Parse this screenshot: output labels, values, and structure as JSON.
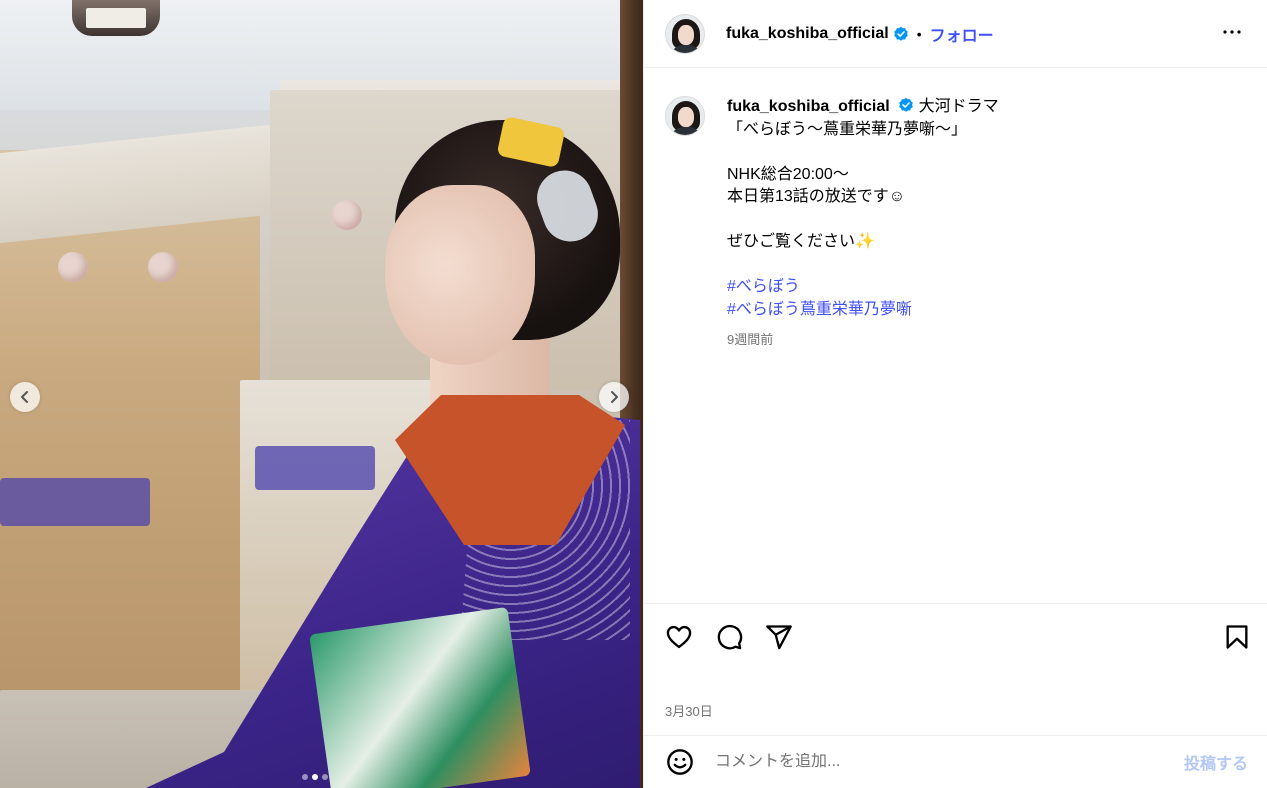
{
  "header": {
    "username": "fuka_koshiba_official",
    "separator": "•",
    "follow_label": "フォロー"
  },
  "caption": {
    "username": "fuka_koshiba_official",
    "lines": [
      "大河ドラマ",
      "「べらぼう～蔦重栄華乃夢噺～」",
      "",
      "NHK総合20:00～",
      "本日第13話の放送です☺",
      "",
      "ぜひご覧ください✨",
      ""
    ],
    "hashtags": [
      "#べらぼう",
      "#べらぼう蔦重栄華乃夢噺"
    ],
    "time_ago": "9週間前"
  },
  "media": {
    "carousel_total": 3,
    "carousel_active": 2
  },
  "actions": {
    "icons": [
      "heart-icon",
      "comment-icon",
      "share-icon",
      "bookmark-icon"
    ]
  },
  "post_date": "3月30日",
  "comment": {
    "placeholder": "コメントを追加...",
    "post_label": "投稿する"
  },
  "colors": {
    "accent": "#4150f7",
    "verified": "#0095f6",
    "post_button_disabled": "#b3c7f7",
    "muted_text": "#737373"
  }
}
